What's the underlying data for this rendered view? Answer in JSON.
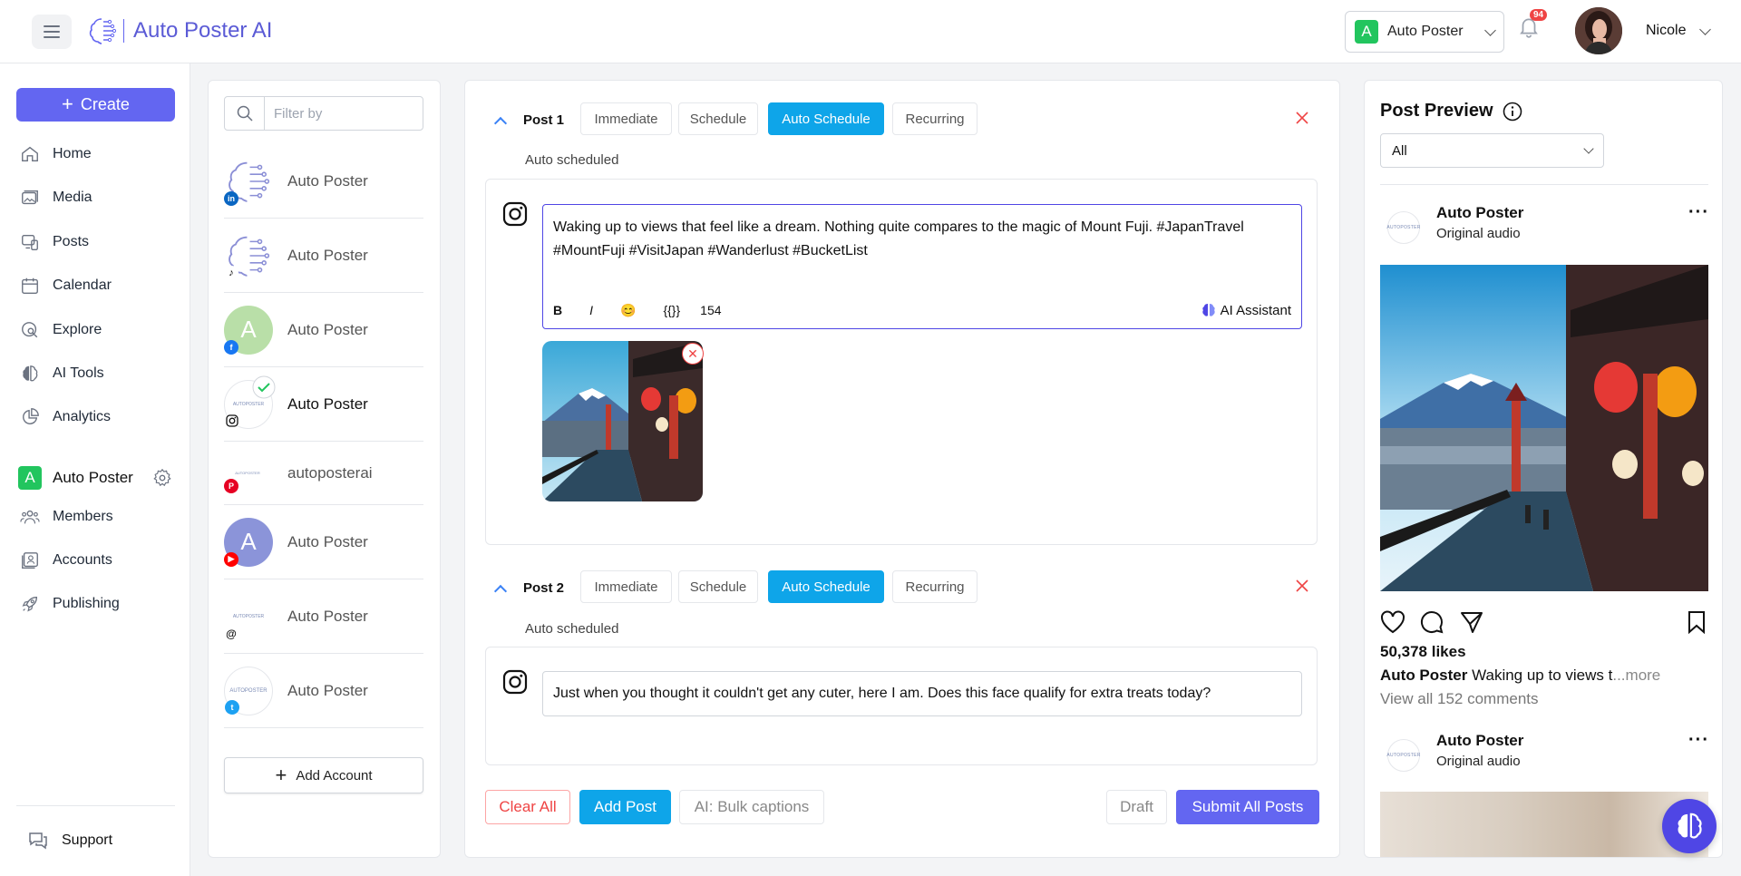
{
  "app": {
    "title": "Auto Poster AI"
  },
  "header": {
    "workspace": {
      "letter": "A",
      "name": "Auto Poster"
    },
    "notifications": {
      "count": "94"
    },
    "user": {
      "name": "Nicole"
    }
  },
  "sidebar": {
    "create_label": "Create",
    "items": [
      {
        "label": "Home",
        "icon": "home-icon"
      },
      {
        "label": "Media",
        "icon": "media-icon"
      },
      {
        "label": "Posts",
        "icon": "posts-icon"
      },
      {
        "label": "Calendar",
        "icon": "calendar-icon"
      },
      {
        "label": "Explore",
        "icon": "explore-icon"
      },
      {
        "label": "AI Tools",
        "icon": "brain-icon"
      },
      {
        "label": "Analytics",
        "icon": "analytics-icon"
      }
    ],
    "workspace": {
      "letter": "A",
      "name": "Auto Poster"
    },
    "workspace_items": [
      {
        "label": "Members",
        "icon": "members-icon"
      },
      {
        "label": "Accounts",
        "icon": "accounts-icon"
      },
      {
        "label": "Publishing",
        "icon": "rocket-icon"
      }
    ],
    "support_label": "Support"
  },
  "accounts": {
    "filter_placeholder": "Filter by",
    "list": [
      {
        "name": "Auto Poster",
        "network": "linkedin",
        "selected": false
      },
      {
        "name": "Auto Poster",
        "network": "tiktok",
        "selected": false
      },
      {
        "name": "Auto Poster",
        "network": "facebook",
        "avatar_letter": "A",
        "selected": false
      },
      {
        "name": "Auto Poster",
        "network": "instagram",
        "selected": true
      },
      {
        "name": "autoposterai",
        "network": "pinterest",
        "selected": false
      },
      {
        "name": "Auto Poster",
        "network": "youtube",
        "avatar_letter": "A",
        "selected": false
      },
      {
        "name": "Auto Poster",
        "network": "threads",
        "selected": false
      },
      {
        "name": "Auto Poster",
        "network": "twitter",
        "selected": false
      }
    ],
    "add_label": "Add Account"
  },
  "composer": {
    "tabs": [
      "Immediate",
      "Schedule",
      "Auto Schedule",
      "Recurring"
    ],
    "active_tab": "Auto Schedule",
    "posts": [
      {
        "label": "Post 1",
        "status": "Auto scheduled",
        "text": "Waking up to views that feel like a dream. Nothing quite compares to the magic of Mount Fuji. #JapanTravel #MountFuji #VisitJapan #Wanderlust #BucketList",
        "toolbar": {
          "bold": "B",
          "italic": "I",
          "emoji": "😊",
          "variables": "{{}}",
          "char_count": "154",
          "ai_label": "AI Assistant"
        }
      },
      {
        "label": "Post 2",
        "status": "Auto scheduled",
        "text": "Just when you thought it couldn't get any cuter, here I am. Does this face qualify for extra treats today?"
      }
    ],
    "footer": {
      "clear_all": "Clear All",
      "add_post": "Add Post",
      "bulk_captions": "AI: Bulk captions",
      "draft": "Draft",
      "submit": "Submit All Posts"
    }
  },
  "preview": {
    "title": "Post Preview",
    "filter_value": "All",
    "account_logo_text": "AUTOPOSTER",
    "posts": [
      {
        "account": "Auto Poster",
        "audio": "Original audio",
        "likes": "50,378 likes",
        "caption_user": "Auto Poster",
        "caption_text": "Waking up to views t",
        "more": "...more",
        "comments": "View all 152 comments"
      },
      {
        "account": "Auto Poster",
        "audio": "Original audio"
      }
    ]
  },
  "colors": {
    "accent": "#6366f1",
    "tab_active": "#0ea5e9",
    "danger": "#ef4444",
    "workspace_green": "#22c55e"
  }
}
